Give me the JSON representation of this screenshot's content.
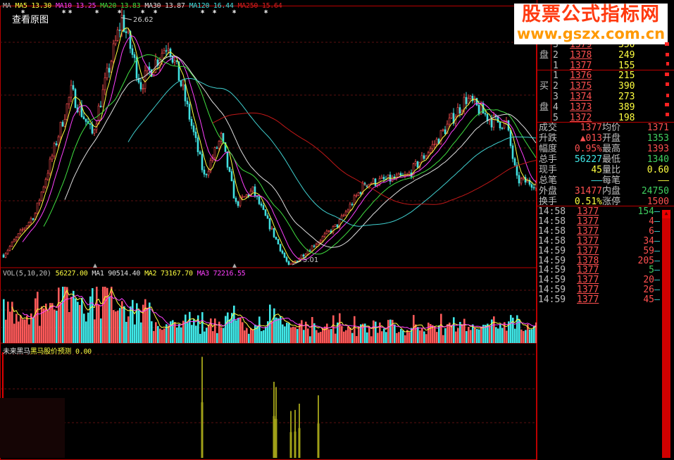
{
  "ma_legend": [
    {
      "label": "MA",
      "value": "",
      "color": "#c0c0c0"
    },
    {
      "label": "MA5",
      "value": "13.30",
      "color": "#ffff40"
    },
    {
      "label": "MA10",
      "value": "13.25",
      "color": "#ff40ff"
    },
    {
      "label": "MA20",
      "value": "13.83",
      "color": "#40e040"
    },
    {
      "label": "MA30",
      "value": "13.87",
      "color": "#e0e0e0"
    },
    {
      "label": "MA120",
      "value": "16.44",
      "color": "#40e0e0"
    },
    {
      "label": "MA250",
      "value": "15.64",
      "color": "#e02020"
    }
  ],
  "view_original": "查看原图",
  "price_high_label": "26.62",
  "price_low_label": "5.01",
  "vol_legend": [
    {
      "label": "VOL(5,10,20)",
      "value": "",
      "color": "#c0c0c0"
    },
    {
      "label": "",
      "value": "56227.00",
      "color": "#ffff40"
    },
    {
      "label": "MA1",
      "value": "90514.40",
      "color": "#e0e0e0"
    },
    {
      "label": "MA2",
      "value": "73167.70",
      "color": "#ffff40"
    },
    {
      "label": "MA3",
      "value": "72216.55",
      "color": "#ff40ff"
    }
  ],
  "indicator_legend": {
    "name": "未来黑马",
    "title": "黑马股价预测",
    "value": "0.00"
  },
  "price_path": [
    [
      0,
      6.0
    ],
    [
      15,
      9.6
    ],
    [
      32,
      20.2
    ],
    [
      42,
      16.5
    ],
    [
      56,
      26.6
    ],
    [
      65,
      20.8
    ],
    [
      78,
      24.5
    ],
    [
      85,
      20.2
    ],
    [
      95,
      12.8
    ],
    [
      103,
      16.2
    ],
    [
      110,
      10.4
    ],
    [
      118,
      11.6
    ],
    [
      135,
      5.0
    ],
    [
      158,
      8.6
    ],
    [
      171,
      12.2
    ],
    [
      191,
      12.8
    ],
    [
      205,
      15.9
    ],
    [
      219,
      19.6
    ],
    [
      231,
      17.7
    ],
    [
      238,
      17.4
    ],
    [
      243,
      12.5
    ],
    [
      252,
      12.2
    ]
  ],
  "indicator_bars": [
    [
      94,
      0.97
    ],
    [
      128,
      0.73
    ],
    [
      129,
      0.68
    ],
    [
      136,
      0.45
    ],
    [
      138,
      0.46
    ],
    [
      140,
      0.52
    ],
    [
      149,
      0.6
    ]
  ],
  "watermark": {
    "line1": "股票公式指标网",
    "line2": "www.gszx.com.cn"
  },
  "order_book": {
    "sell_label": "盘",
    "buy_label1": "买",
    "buy_label2": "盘",
    "sell": [
      {
        "n": "3",
        "price": "1379",
        "vol": "350"
      },
      {
        "n": "2",
        "price": "1378",
        "vol": "249"
      },
      {
        "n": "1",
        "price": "1377",
        "vol": "155"
      }
    ],
    "buy": [
      {
        "n": "1",
        "price": "1376",
        "vol": "215"
      },
      {
        "n": "2",
        "price": "1375",
        "vol": "390"
      },
      {
        "n": "3",
        "price": "1374",
        "vol": "273"
      },
      {
        "n": "4",
        "price": "1373",
        "vol": "389"
      },
      {
        "n": "5",
        "price": "1372",
        "vol": "198"
      }
    ]
  },
  "stats": [
    {
      "l1": "成交",
      "v1": "1377",
      "c1": "red",
      "l2": "均价",
      "v2": "1371",
      "c2": "red"
    },
    {
      "l1": "升跌",
      "v1": "▲013",
      "c1": "red",
      "l2": "开盘",
      "v2": "1353",
      "c2": "grn"
    },
    {
      "l1": "幅度",
      "v1": "0.95%",
      "c1": "red",
      "l2": "最高",
      "v2": "1393",
      "c2": "red"
    },
    {
      "l1": "总手",
      "v1": "56227",
      "c1": "cyan",
      "l2": "最低",
      "v2": "1340",
      "c2": "grn"
    },
    {
      "l1": "现手",
      "v1": "45",
      "c1": "yel",
      "l2": "量比",
      "v2": "0.60",
      "c2": "yel"
    },
    {
      "l1": "总笔",
      "v1": "——",
      "c1": "cyan",
      "l2": "每笔",
      "v2": "——",
      "c2": "yel"
    },
    {
      "l1": "外盘",
      "v1": "31477",
      "c1": "red",
      "l2": "内盘",
      "v2": "24750",
      "c2": "grn"
    },
    {
      "l1": "换手",
      "v1": "0.51%",
      "c1": "yel",
      "l2": "涨停",
      "v2": "1500",
      "c2": "red"
    }
  ],
  "ticks": [
    {
      "time": "14:58",
      "price": "1377",
      "vol": "154",
      "c": "grn"
    },
    {
      "time": "14:58",
      "price": "1377",
      "vol": "4",
      "c": "red"
    },
    {
      "time": "14:58",
      "price": "1377",
      "vol": "6",
      "c": "red"
    },
    {
      "time": "14:58",
      "price": "1377",
      "vol": "34",
      "c": "red"
    },
    {
      "time": "14:59",
      "price": "1377",
      "vol": "59",
      "c": "red"
    },
    {
      "time": "14:59",
      "price": "1378",
      "vol": "205",
      "c": "red"
    },
    {
      "time": "14:59",
      "price": "1377",
      "vol": "5",
      "c": "grn"
    },
    {
      "time": "14:59",
      "price": "1377",
      "vol": "20",
      "c": "red"
    },
    {
      "time": "14:59",
      "price": "1377",
      "vol": "26",
      "c": "red"
    },
    {
      "time": "14:59",
      "price": "1377",
      "vol": "45",
      "c": "red"
    }
  ]
}
